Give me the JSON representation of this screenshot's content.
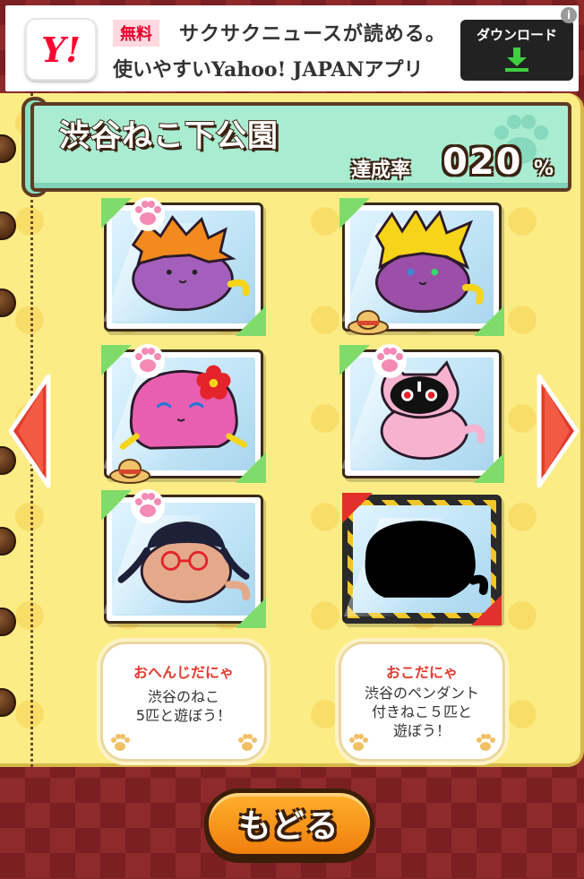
{
  "ad": {
    "logo_text": "Y!",
    "free_label": "無料",
    "line1": "サクサクニュースが読める。",
    "line2": "使いやすいYahoo! JAPANアプリ",
    "download_label": "ダウンロード",
    "info_label": "i"
  },
  "area": {
    "title": "渋谷ねこ下公園",
    "rate_label": "達成率",
    "rate_value": "020",
    "rate_unit": "%"
  },
  "cats": [
    {
      "name": "orange-hair-cat",
      "body": "#a45fbd",
      "hair": "#f28a1e",
      "status": "collected",
      "paw": true,
      "hat": false
    },
    {
      "name": "yellow-hair-cat",
      "body": "#9b4fa8",
      "hair": "#f5d419",
      "status": "collected",
      "paw": false,
      "hat": true
    },
    {
      "name": "pink-flower-cat",
      "body": "#e85fb2",
      "hair": "#e85fb2",
      "status": "collected",
      "paw": true,
      "hat": true
    },
    {
      "name": "black-pink-cat",
      "body": "#f6b3cf",
      "hair": "#111111",
      "status": "collected",
      "paw": true,
      "hat": false
    },
    {
      "name": "glasses-braid-cat",
      "body": "#e3a98a",
      "hair": "#1e2038",
      "status": "collected",
      "paw": true,
      "hat": false
    },
    {
      "name": "locked-cat",
      "body": "#000000",
      "hair": "#000000",
      "status": "locked",
      "paw": false,
      "hat": false
    }
  ],
  "missions": [
    {
      "title": "おへんじだにゃ",
      "body": "渋谷のねこ\n5匹と遊ぼう！"
    },
    {
      "title": "おこだにゃ",
      "body": "渋谷のペンダント\n付きねこ５匹と\n遊ぼう！"
    }
  ],
  "navigation": {
    "prev_icon": "left-arrow-icon",
    "next_icon": "right-arrow-icon",
    "back_label": "もどる"
  },
  "colors": {
    "notebook": "#fcec86",
    "ribbon": "#a8ecd2",
    "collected_corner": "#7fdc6b",
    "locked_corner": "#e4302a",
    "mission_title": "#e53a2e",
    "back_button": "#f79a1c"
  }
}
